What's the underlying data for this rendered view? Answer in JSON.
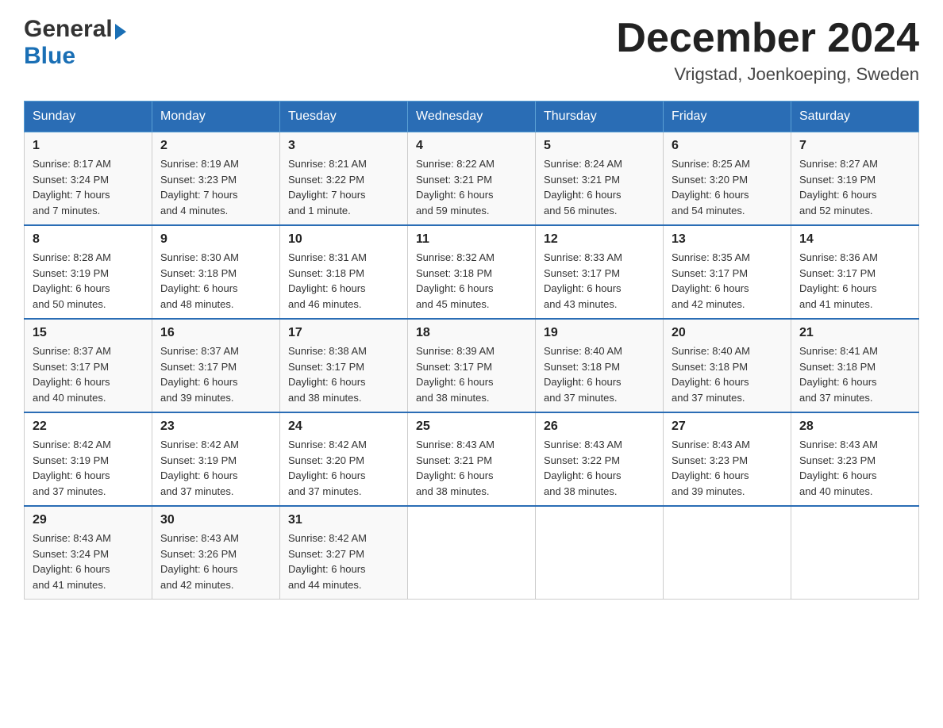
{
  "logo": {
    "general": "General",
    "blue": "Blue"
  },
  "title": "December 2024",
  "location": "Vrigstad, Joenkoeping, Sweden",
  "days_of_week": [
    "Sunday",
    "Monday",
    "Tuesday",
    "Wednesday",
    "Thursday",
    "Friday",
    "Saturday"
  ],
  "weeks": [
    [
      {
        "day": "1",
        "sunrise": "8:17 AM",
        "sunset": "3:24 PM",
        "daylight": "7 hours and 7 minutes."
      },
      {
        "day": "2",
        "sunrise": "8:19 AM",
        "sunset": "3:23 PM",
        "daylight": "7 hours and 4 minutes."
      },
      {
        "day": "3",
        "sunrise": "8:21 AM",
        "sunset": "3:22 PM",
        "daylight": "7 hours and 1 minute."
      },
      {
        "day": "4",
        "sunrise": "8:22 AM",
        "sunset": "3:21 PM",
        "daylight": "6 hours and 59 minutes."
      },
      {
        "day": "5",
        "sunrise": "8:24 AM",
        "sunset": "3:21 PM",
        "daylight": "6 hours and 56 minutes."
      },
      {
        "day": "6",
        "sunrise": "8:25 AM",
        "sunset": "3:20 PM",
        "daylight": "6 hours and 54 minutes."
      },
      {
        "day": "7",
        "sunrise": "8:27 AM",
        "sunset": "3:19 PM",
        "daylight": "6 hours and 52 minutes."
      }
    ],
    [
      {
        "day": "8",
        "sunrise": "8:28 AM",
        "sunset": "3:19 PM",
        "daylight": "6 hours and 50 minutes."
      },
      {
        "day": "9",
        "sunrise": "8:30 AM",
        "sunset": "3:18 PM",
        "daylight": "6 hours and 48 minutes."
      },
      {
        "day": "10",
        "sunrise": "8:31 AM",
        "sunset": "3:18 PM",
        "daylight": "6 hours and 46 minutes."
      },
      {
        "day": "11",
        "sunrise": "8:32 AM",
        "sunset": "3:18 PM",
        "daylight": "6 hours and 45 minutes."
      },
      {
        "day": "12",
        "sunrise": "8:33 AM",
        "sunset": "3:17 PM",
        "daylight": "6 hours and 43 minutes."
      },
      {
        "day": "13",
        "sunrise": "8:35 AM",
        "sunset": "3:17 PM",
        "daylight": "6 hours and 42 minutes."
      },
      {
        "day": "14",
        "sunrise": "8:36 AM",
        "sunset": "3:17 PM",
        "daylight": "6 hours and 41 minutes."
      }
    ],
    [
      {
        "day": "15",
        "sunrise": "8:37 AM",
        "sunset": "3:17 PM",
        "daylight": "6 hours and 40 minutes."
      },
      {
        "day": "16",
        "sunrise": "8:37 AM",
        "sunset": "3:17 PM",
        "daylight": "6 hours and 39 minutes."
      },
      {
        "day": "17",
        "sunrise": "8:38 AM",
        "sunset": "3:17 PM",
        "daylight": "6 hours and 38 minutes."
      },
      {
        "day": "18",
        "sunrise": "8:39 AM",
        "sunset": "3:17 PM",
        "daylight": "6 hours and 38 minutes."
      },
      {
        "day": "19",
        "sunrise": "8:40 AM",
        "sunset": "3:18 PM",
        "daylight": "6 hours and 37 minutes."
      },
      {
        "day": "20",
        "sunrise": "8:40 AM",
        "sunset": "3:18 PM",
        "daylight": "6 hours and 37 minutes."
      },
      {
        "day": "21",
        "sunrise": "8:41 AM",
        "sunset": "3:18 PM",
        "daylight": "6 hours and 37 minutes."
      }
    ],
    [
      {
        "day": "22",
        "sunrise": "8:42 AM",
        "sunset": "3:19 PM",
        "daylight": "6 hours and 37 minutes."
      },
      {
        "day": "23",
        "sunrise": "8:42 AM",
        "sunset": "3:19 PM",
        "daylight": "6 hours and 37 minutes."
      },
      {
        "day": "24",
        "sunrise": "8:42 AM",
        "sunset": "3:20 PM",
        "daylight": "6 hours and 37 minutes."
      },
      {
        "day": "25",
        "sunrise": "8:43 AM",
        "sunset": "3:21 PM",
        "daylight": "6 hours and 38 minutes."
      },
      {
        "day": "26",
        "sunrise": "8:43 AM",
        "sunset": "3:22 PM",
        "daylight": "6 hours and 38 minutes."
      },
      {
        "day": "27",
        "sunrise": "8:43 AM",
        "sunset": "3:23 PM",
        "daylight": "6 hours and 39 minutes."
      },
      {
        "day": "28",
        "sunrise": "8:43 AM",
        "sunset": "3:23 PM",
        "daylight": "6 hours and 40 minutes."
      }
    ],
    [
      {
        "day": "29",
        "sunrise": "8:43 AM",
        "sunset": "3:24 PM",
        "daylight": "6 hours and 41 minutes."
      },
      {
        "day": "30",
        "sunrise": "8:43 AM",
        "sunset": "3:26 PM",
        "daylight": "6 hours and 42 minutes."
      },
      {
        "day": "31",
        "sunrise": "8:42 AM",
        "sunset": "3:27 PM",
        "daylight": "6 hours and 44 minutes."
      },
      null,
      null,
      null,
      null
    ]
  ],
  "labels": {
    "sunrise": "Sunrise:",
    "sunset": "Sunset:",
    "daylight": "Daylight:"
  }
}
